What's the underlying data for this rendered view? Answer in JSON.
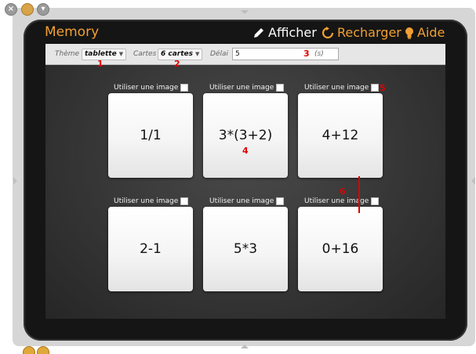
{
  "app": {
    "title": "Memory",
    "accent_color": "#f0a033",
    "actions": [
      {
        "label": "Afficher",
        "icon": "pencil-icon"
      },
      {
        "label": "Recharger",
        "icon": "reload-icon"
      },
      {
        "label": "Aide",
        "icon": "lightbulb-icon"
      }
    ]
  },
  "toolbar": {
    "theme_label": "Thème",
    "theme_value": "tablette",
    "cards_label": "Cartes",
    "cards_value": "6 cartes",
    "delay_label": "Délai",
    "delay_value": "5",
    "delay_unit": "(s)"
  },
  "cards": [
    {
      "option_label": "Utiliser une image",
      "expression": "1/1"
    },
    {
      "option_label": "Utiliser une image",
      "expression": "3*(3+2)"
    },
    {
      "option_label": "Utiliser une image",
      "expression": "4+12"
    },
    {
      "option_label": "Utiliser une image",
      "expression": "2-1"
    },
    {
      "option_label": "Utiliser une image",
      "expression": "5*3"
    },
    {
      "option_label": "Utiliser une image",
      "expression": "0+16"
    }
  ],
  "annotations": [
    "1",
    "2",
    "3",
    "4",
    "5",
    "6"
  ],
  "annotation_color": "#e00000"
}
